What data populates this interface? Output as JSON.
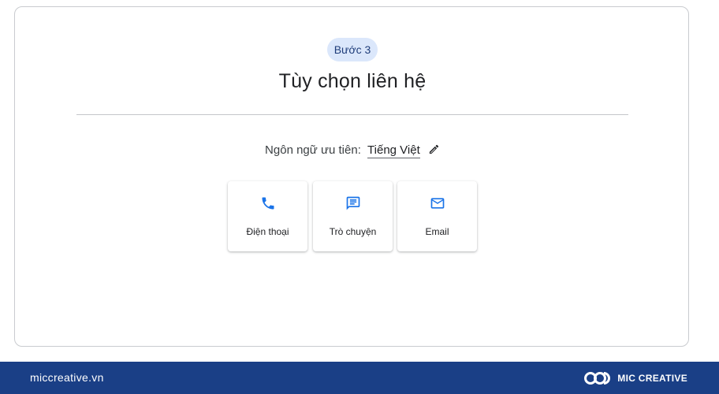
{
  "step_badge": "Bước 3",
  "title": "Tùy chọn liên hệ",
  "language": {
    "label": "Ngôn ngữ ưu tiên:",
    "value": "Tiếng Việt",
    "edit_icon": "pencil-icon"
  },
  "contact_options": [
    {
      "label": "Điện thoại",
      "icon": "phone-icon"
    },
    {
      "label": "Trò chuyện",
      "icon": "chat-icon"
    },
    {
      "label": "Email",
      "icon": "email-icon"
    }
  ],
  "footer": {
    "site": "miccreative.vn",
    "brand": "MIC CREATIVE"
  },
  "colors": {
    "accent_blue": "#1a73e8",
    "badge_bg": "#dbe7fb",
    "footer_bg": "#1a3f86"
  }
}
